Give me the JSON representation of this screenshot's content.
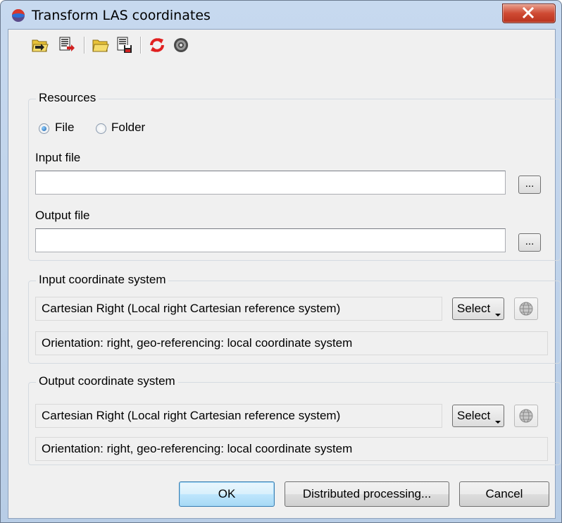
{
  "window": {
    "title": "Transform LAS coordinates"
  },
  "toolbar": {
    "buttons": [
      {
        "name": "open-settings",
        "icon": "open-arrow-icon"
      },
      {
        "name": "save-settings",
        "icon": "save-arrow-icon"
      },
      {
        "name": "open",
        "icon": "folder-open-icon"
      },
      {
        "name": "save",
        "icon": "save-icon"
      },
      {
        "name": "reset",
        "icon": "refresh-icon"
      },
      {
        "name": "settings",
        "icon": "gear-icon"
      }
    ]
  },
  "resources": {
    "title": "Resources",
    "radio_file": "File",
    "radio_folder": "Folder",
    "selected": "File",
    "input_label": "Input file",
    "input_value": "",
    "output_label": "Output file",
    "output_value": "",
    "browse_label": "..."
  },
  "input_cs": {
    "title": "Input coordinate system",
    "value": "Cartesian Right (Local right Cartesian reference system)",
    "select_label": "Select",
    "orientation": "Orientation: right, geo-referencing: local coordinate system"
  },
  "output_cs": {
    "title": "Output coordinate system",
    "value": "Cartesian Right (Local right Cartesian reference system)",
    "select_label": "Select",
    "orientation": "Orientation: right, geo-referencing: local coordinate system"
  },
  "buttons": {
    "ok": "OK",
    "distributed": "Distributed processing...",
    "cancel": "Cancel"
  },
  "colors": {
    "title_bar": "#c7d9ef",
    "close_button": "#cf4a33",
    "client_bg": "#f0f0f0",
    "reset_icon": "#e02020"
  }
}
